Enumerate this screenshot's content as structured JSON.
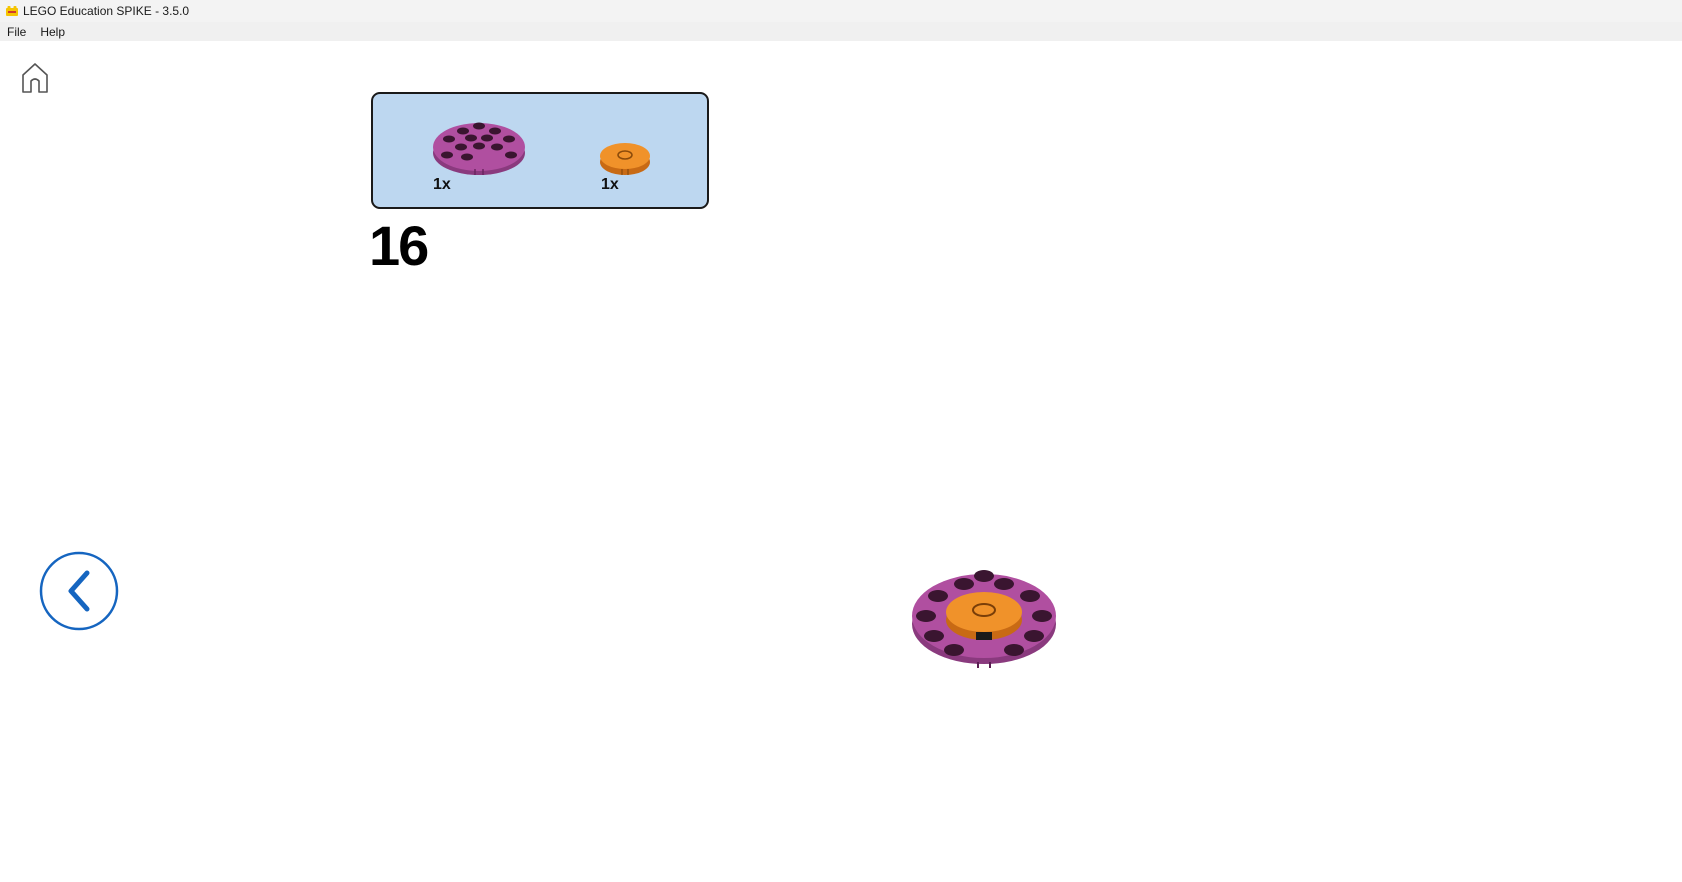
{
  "window": {
    "title": "LEGO Education SPIKE - 3.5.0",
    "icon": "lego-app-icon"
  },
  "menu": {
    "items": [
      {
        "label": "File"
      },
      {
        "label": "Help"
      }
    ]
  },
  "nav": {
    "home_icon": "home-icon",
    "back_icon": "chevron-left-circle-icon"
  },
  "step": {
    "number": "16",
    "parts": [
      {
        "name": "round-plate-4x4-with-studs",
        "color": "#b04fa0",
        "qty": "1x"
      },
      {
        "name": "round-tile-2x2-with-hole",
        "color": "#f0922a",
        "qty": "1x"
      }
    ],
    "parts_box_color": "#bdd7f0"
  },
  "colors": {
    "accent": "#1565c0",
    "magenta_part": "#b04fa0",
    "orange_part": "#f0922a"
  }
}
